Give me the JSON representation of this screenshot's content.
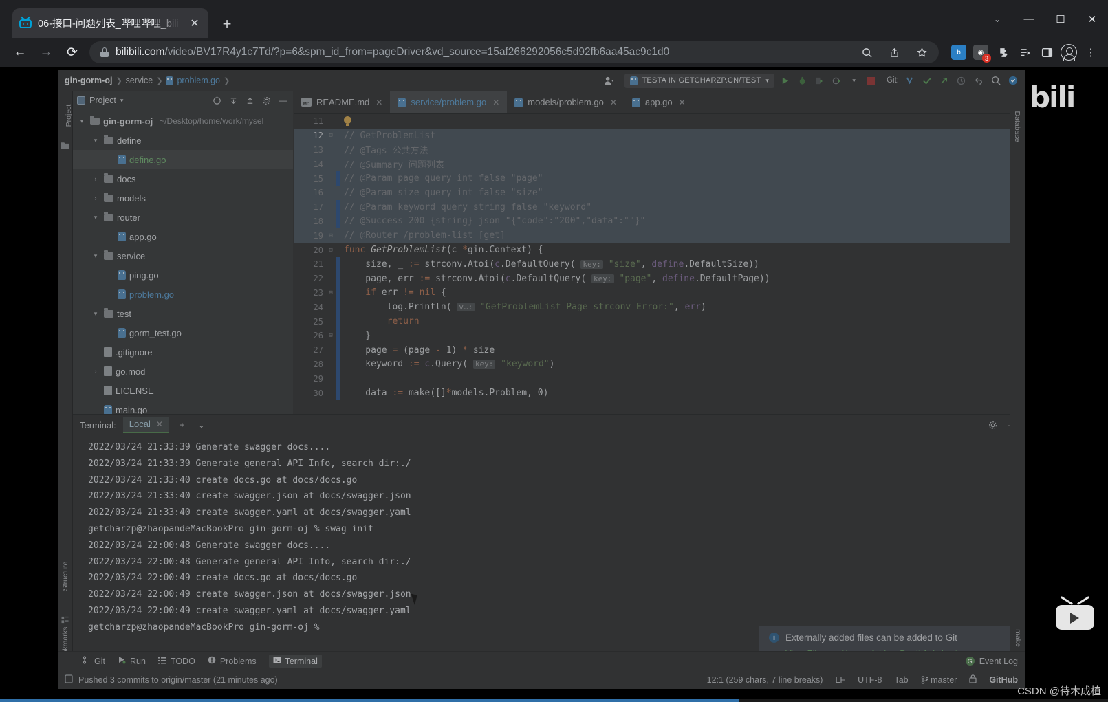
{
  "browser": {
    "tab": {
      "title": "06-接口-问题列表_哔哩哔哩_bili",
      "favicon": "bilibili-tv-icon",
      "close_label": "✕"
    },
    "new_tab_label": "+",
    "window_controls": {
      "tab_search": "⌄",
      "minimize": "—",
      "maximize": "☐",
      "close": "✕"
    },
    "nav": {
      "back": "←",
      "forward": "→",
      "reload": "⟳"
    },
    "url": {
      "host": "bilibili.com",
      "path": "/video/BV17R4y1c7Td/?p=6&spm_id_from=pageDriver&vd_source=15af266292056c5d92fb6aa45ac9c1d0",
      "lock_icon": "lock-icon"
    },
    "omni_icons": {
      "zoom_out": "🔍",
      "share": "↗",
      "bookmark": "☆"
    },
    "extensions": {
      "badge_count": "3"
    }
  },
  "ide": {
    "breadcrumb": [
      {
        "label": "gin-gorm-oj",
        "style": "bold"
      },
      {
        "label": "service",
        "style": "plain"
      },
      {
        "label": "problem.go",
        "style": "blue"
      }
    ],
    "toolbar": {
      "run_config": "TESTA IN GETCHARZP.CN/TEST",
      "git_label": "Git:",
      "buttons": [
        "run-button",
        "debug-button",
        "run-coverage-button",
        "profile-button",
        "stop-button"
      ],
      "git_buttons": [
        "update-project-button",
        "commit-button",
        "push-button",
        "history-button",
        "rollback-button"
      ],
      "search_button": "search-everywhere-icon"
    },
    "project_panel": {
      "title": "Project",
      "icons": [
        "locate-icon",
        "expand-all-icon",
        "collapse-all-icon",
        "settings-icon",
        "hide-icon"
      ],
      "tree": [
        {
          "indent": 0,
          "arrow": "▾",
          "icon": "folder",
          "name": "gin-gorm-oj",
          "bold": true,
          "path": "~/Desktop/home/work/mysel"
        },
        {
          "indent": 1,
          "arrow": "▾",
          "icon": "folder",
          "name": "define"
        },
        {
          "indent": 2,
          "arrow": "",
          "icon": "go",
          "name": "define.go",
          "color": "green",
          "selected": true
        },
        {
          "indent": 1,
          "arrow": "›",
          "icon": "folder",
          "name": "docs"
        },
        {
          "indent": 1,
          "arrow": "›",
          "icon": "folder",
          "name": "models"
        },
        {
          "indent": 1,
          "arrow": "▾",
          "icon": "folder",
          "name": "router"
        },
        {
          "indent": 2,
          "arrow": "",
          "icon": "go",
          "name": "app.go"
        },
        {
          "indent": 1,
          "arrow": "▾",
          "icon": "folder",
          "name": "service"
        },
        {
          "indent": 2,
          "arrow": "",
          "icon": "go",
          "name": "ping.go"
        },
        {
          "indent": 2,
          "arrow": "",
          "icon": "go",
          "name": "problem.go",
          "color": "blue"
        },
        {
          "indent": 1,
          "arrow": "▾",
          "icon": "folder",
          "name": "test"
        },
        {
          "indent": 2,
          "arrow": "",
          "icon": "go",
          "name": "gorm_test.go"
        },
        {
          "indent": 1,
          "arrow": "",
          "icon": "doc",
          "name": ".gitignore"
        },
        {
          "indent": 1,
          "arrow": "›",
          "icon": "doc",
          "name": "go.mod"
        },
        {
          "indent": 1,
          "arrow": "",
          "icon": "doc",
          "name": "LICENSE"
        },
        {
          "indent": 1,
          "arrow": "",
          "icon": "go",
          "name": "main.go"
        }
      ]
    },
    "editor_tabs": [
      {
        "label": "README.md",
        "icon": "md",
        "active": false
      },
      {
        "label": "service/problem.go",
        "icon": "go",
        "active": true
      },
      {
        "label": "models/problem.go",
        "icon": "go",
        "active": false
      },
      {
        "label": "app.go",
        "icon": "go",
        "active": false
      }
    ],
    "code": [
      {
        "no": "11",
        "tokens": [
          {
            "t": "bulb",
            "v": ""
          }
        ]
      },
      {
        "no": "12",
        "hl": true,
        "fold": "⊟",
        "tokens": [
          {
            "t": "com",
            "v": "// GetProblemList"
          }
        ]
      },
      {
        "no": "13",
        "hl": true,
        "tokens": [
          {
            "t": "com",
            "v": "// @Tags 公共方法"
          }
        ]
      },
      {
        "no": "14",
        "hl": true,
        "tokens": [
          {
            "t": "com",
            "v": "// @Summary 问题列表"
          }
        ]
      },
      {
        "no": "15",
        "hl": true,
        "chg": true,
        "tokens": [
          {
            "t": "com",
            "v": "// @Param page query int false \"page\""
          }
        ]
      },
      {
        "no": "16",
        "hl": true,
        "tokens": [
          {
            "t": "com",
            "v": "// @Param size query int false \"size\""
          }
        ]
      },
      {
        "no": "17",
        "hl": true,
        "chg": true,
        "tokens": [
          {
            "t": "com",
            "v": "// @Param keyword query string false \"keyword\""
          }
        ]
      },
      {
        "no": "18",
        "hl": true,
        "chg": true,
        "tokens": [
          {
            "t": "com",
            "v": "// @Success 200 {string} json \"{\"code\":\"200\",\"data\":\"\"}\""
          }
        ]
      },
      {
        "no": "19",
        "hl": true,
        "fold": "⊟",
        "tokens": [
          {
            "t": "com",
            "v": "// @Router /problem-list [get]"
          }
        ]
      },
      {
        "no": "20",
        "fold": "⊟",
        "tokens": [
          {
            "t": "kw",
            "v": "func "
          },
          {
            "t": "fn",
            "v": "GetProblemList"
          },
          {
            "t": "txt",
            "v": "(c "
          },
          {
            "t": "op",
            "v": "*"
          },
          {
            "t": "txt",
            "v": "gin.Context) {"
          }
        ]
      },
      {
        "no": "21",
        "chg": true,
        "tokens": [
          {
            "t": "txt",
            "v": "    size, _ "
          },
          {
            "t": "op",
            "v": ":= "
          },
          {
            "t": "txt",
            "v": "strconv.Atoi("
          },
          {
            "t": "field",
            "v": "c"
          },
          {
            "t": "txt",
            "v": ".DefaultQuery( "
          },
          {
            "t": "hint",
            "v": "key:"
          },
          {
            "t": "str",
            "v": " \"size\""
          },
          {
            "t": "txt",
            "v": ", "
          },
          {
            "t": "field",
            "v": "define"
          },
          {
            "t": "txt",
            "v": ".DefaultSize))"
          }
        ]
      },
      {
        "no": "22",
        "chg": true,
        "tokens": [
          {
            "t": "txt",
            "v": "    page, err "
          },
          {
            "t": "op",
            "v": ":= "
          },
          {
            "t": "txt",
            "v": "strconv.Atoi("
          },
          {
            "t": "field",
            "v": "c"
          },
          {
            "t": "txt",
            "v": ".DefaultQuery( "
          },
          {
            "t": "hint",
            "v": "key:"
          },
          {
            "t": "str",
            "v": " \"page\""
          },
          {
            "t": "txt",
            "v": ", "
          },
          {
            "t": "field",
            "v": "define"
          },
          {
            "t": "txt",
            "v": ".DefaultPage))"
          }
        ]
      },
      {
        "no": "23",
        "chg": true,
        "fold": "⊟",
        "tokens": [
          {
            "t": "kw",
            "v": "    if "
          },
          {
            "t": "txt",
            "v": "err "
          },
          {
            "t": "op",
            "v": "!= "
          },
          {
            "t": "kw",
            "v": "nil"
          },
          {
            "t": "txt",
            "v": " {"
          }
        ]
      },
      {
        "no": "24",
        "chg": true,
        "tokens": [
          {
            "t": "txt",
            "v": "        log.Println( "
          },
          {
            "t": "hint",
            "v": "v…:"
          },
          {
            "t": "str",
            "v": " \"GetProblemList Page strconv Error:\""
          },
          {
            "t": "txt",
            "v": ", "
          },
          {
            "t": "field",
            "v": "err"
          },
          {
            "t": "txt",
            "v": ")"
          }
        ]
      },
      {
        "no": "25",
        "chg": true,
        "tokens": [
          {
            "t": "kw",
            "v": "        return"
          }
        ]
      },
      {
        "no": "26",
        "chg": true,
        "fold": "⊟",
        "tokens": [
          {
            "t": "txt",
            "v": "    }"
          }
        ]
      },
      {
        "no": "27",
        "chg": true,
        "tokens": [
          {
            "t": "txt",
            "v": "    page "
          },
          {
            "t": "op",
            "v": "= "
          },
          {
            "t": "txt",
            "v": "(page "
          },
          {
            "t": "op",
            "v": "- "
          },
          {
            "t": "txt",
            "v": "1) "
          },
          {
            "t": "op",
            "v": "* "
          },
          {
            "t": "txt",
            "v": "size"
          }
        ]
      },
      {
        "no": "28",
        "chg": true,
        "tokens": [
          {
            "t": "txt",
            "v": "    keyword "
          },
          {
            "t": "op",
            "v": ":= "
          },
          {
            "t": "field",
            "v": "c"
          },
          {
            "t": "txt",
            "v": ".Query( "
          },
          {
            "t": "hint",
            "v": "key:"
          },
          {
            "t": "str",
            "v": " \"keyword\""
          },
          {
            "t": "txt",
            "v": ")"
          }
        ]
      },
      {
        "no": "29",
        "chg": true,
        "tokens": [
          {
            "t": "txt",
            "v": ""
          }
        ]
      },
      {
        "no": "30",
        "chg": true,
        "tokens": [
          {
            "t": "txt",
            "v": "    data "
          },
          {
            "t": "op",
            "v": ":= "
          },
          {
            "t": "txt",
            "v": "make([]"
          },
          {
            "t": "op",
            "v": "*"
          },
          {
            "t": "txt",
            "v": "models.Problem, 0)"
          }
        ]
      }
    ],
    "terminal": {
      "label": "Terminal:",
      "tab": "Local",
      "add_label": "+",
      "dropdown_label": "⌄",
      "settings_icon": "gear-icon",
      "hide_icon": "hide-icon",
      "lines": [
        "2022/03/24 21:33:39 Generate swagger docs....",
        "2022/03/24 21:33:39 Generate general API Info, search dir:./",
        "2022/03/24 21:33:40 create docs.go at  docs/docs.go",
        "2022/03/24 21:33:40 create swagger.json at  docs/swagger.json",
        "2022/03/24 21:33:40 create swagger.yaml at  docs/swagger.yaml",
        "getcharzp@zhaopandeMacBookPro gin-gorm-oj % swag init",
        "2022/03/24 22:00:48 Generate swagger docs....",
        "2022/03/24 22:00:48 Generate general API Info, search dir:./",
        "2022/03/24 22:00:49 create docs.go at  docs/docs.go",
        "2022/03/24 22:00:49 create swagger.json at  docs/swagger.json",
        "2022/03/24 22:00:49 create swagger.yaml at  docs/swagger.yaml",
        "getcharzp@zhaopandeMacBookPro gin-gorm-oj %"
      ]
    },
    "notification": {
      "message": "Externally added files can be added to Git",
      "actions": [
        "View Files",
        "Always Add",
        "Don't Ask Again"
      ]
    },
    "tool_windows": [
      {
        "label": "Git",
        "icon": "branch-icon"
      },
      {
        "label": "Run",
        "icon": "run-icon"
      },
      {
        "label": "TODO",
        "icon": "list-icon"
      },
      {
        "label": "Problems",
        "icon": "warning-icon"
      },
      {
        "label": "Terminal",
        "icon": "terminal-icon",
        "active": true
      }
    ],
    "event_log": "Event Log",
    "status_bar": {
      "message": "Pushed 3 commits to origin/master (21 minutes ago)",
      "caret": "12:1 (259 chars, 7 line breaks)",
      "line_sep": "LF",
      "encoding": "UTF-8",
      "indent": "Tab",
      "branch": "master",
      "lock_icon": "lock-icon",
      "github": "GitHub"
    },
    "left_rail": [
      "Project",
      "Structure",
      "Bookmarks"
    ],
    "right_rail": [
      "Database",
      "make"
    ]
  },
  "overlay": {
    "bili_logo": "bili",
    "watermark": "CSDN @待木成植"
  }
}
